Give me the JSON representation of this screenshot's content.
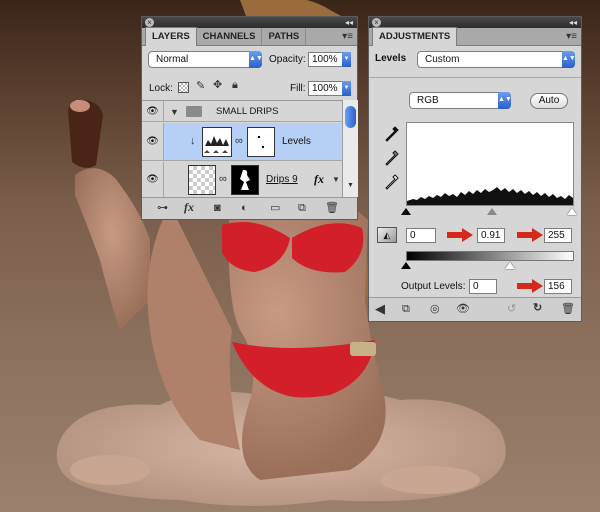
{
  "layers_panel": {
    "tabs": [
      "LAYERS",
      "CHANNELS",
      "PATHS"
    ],
    "blend_mode": "Normal",
    "opacity_label": "Opacity:",
    "opacity_value": "100%",
    "lock_label": "Lock:",
    "fill_label": "Fill:",
    "fill_value": "100%",
    "group_name": "SMALL DRIPS",
    "adjustment_layer_name": "Levels",
    "layer_name": "Drips 9",
    "fx_label": "fx"
  },
  "adjustments_panel": {
    "tab": "ADJUSTMENTS",
    "title": "Levels",
    "preset": "Custom",
    "channel": "RGB",
    "auto_label": "Auto",
    "input_black": "0",
    "input_gamma": "0.91",
    "input_white": "255",
    "output_label": "Output Levels:",
    "output_black": "0",
    "output_white": "156"
  },
  "colors": {
    "accent_blue": "#2a5fc9",
    "selection": "#b5cff7",
    "red_arrow": "#d42a1e"
  }
}
